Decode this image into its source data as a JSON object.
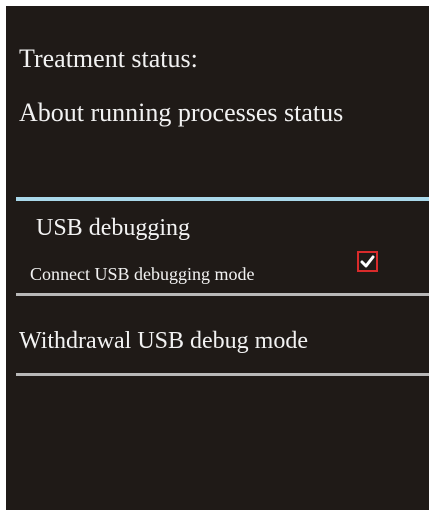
{
  "status": {
    "title": "Treatment status:",
    "value": "About running processes status"
  },
  "usb_debugging": {
    "title": "USB debugging",
    "summary": "Connect USB debugging mode",
    "checked": true
  },
  "withdrawal": {
    "label": "Withdrawal USB debug mode"
  },
  "colors": {
    "background": "#1f1a17",
    "text": "#f2f2f2",
    "accent_divider": "#a9d8ea",
    "divider": "#b8b8b8",
    "checkbox_border": "#d92b2b"
  }
}
